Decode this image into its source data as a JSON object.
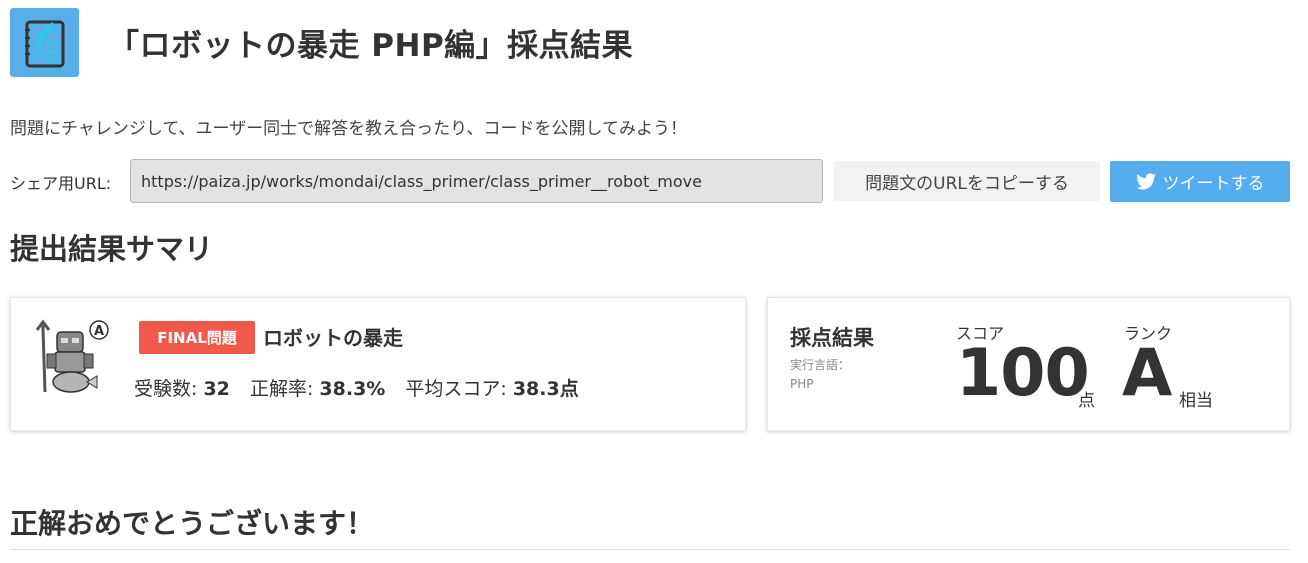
{
  "header": {
    "icon": "checklist-pencil-icon",
    "title": "「ロボットの暴走 PHP編」採点結果"
  },
  "intro": "問題にチャレンジして、ユーザー同士で解答を教え合ったり、コードを公開してみよう！",
  "share": {
    "label": "シェア用URL:",
    "url": "https://paiza.jp/works/mondai/class_primer/class_primer__robot_move",
    "copy_button": "問題文のURLをコピーする",
    "tweet_button": "ツイートする",
    "tweet_icon": "twitter-bird-icon"
  },
  "summary": {
    "title": "提出結果サマリ",
    "problem": {
      "character_icon": "robot-character-icon",
      "rank_mark": "Ⓐ",
      "badge": "FINAL問題",
      "name": "ロボットの暴走",
      "examinees_label": "受験数:",
      "examinees_value": "32",
      "accuracy_label": "正解率:",
      "accuracy_value": "38.3%",
      "avg_score_label": "平均スコア:",
      "avg_score_value": "38.3点"
    },
    "result": {
      "title": "採点結果",
      "language_label": "実行言語：",
      "language_value": "PHP",
      "score_label": "スコア",
      "score_value": "100",
      "score_unit": "点",
      "rank_label": "ランク",
      "rank_value": "A",
      "rank_unit": "相当"
    }
  },
  "congrats": "正解おめでとうございます！",
  "colors": {
    "header_icon_bg": "#57aee8",
    "tweet_button_bg": "#55acee",
    "final_badge_bg": "#ef5a4b",
    "text": "#333333"
  }
}
